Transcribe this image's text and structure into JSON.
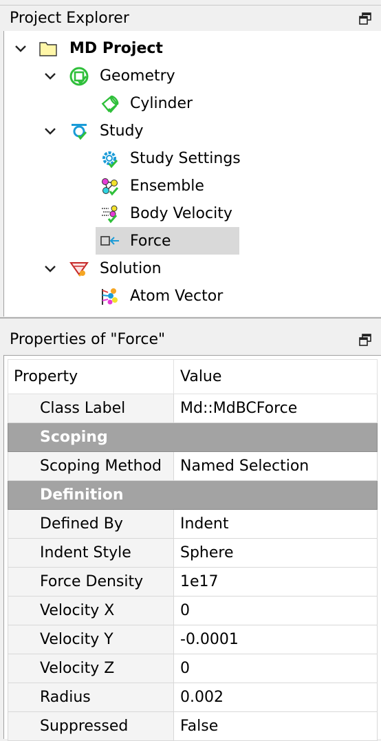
{
  "explorer": {
    "title": "Project Explorer",
    "float_icon": "float-window-icon",
    "tree": [
      {
        "label": "MD Project",
        "icon": "folder-icon",
        "expanded": true,
        "bold": true
      },
      {
        "label": "Geometry",
        "icon": "geometry-icon",
        "expanded": true
      },
      {
        "label": "Cylinder",
        "icon": "cylinder-icon"
      },
      {
        "label": "Study",
        "icon": "study-icon",
        "expanded": true
      },
      {
        "label": "Study Settings",
        "icon": "settings-gear-icon"
      },
      {
        "label": "Ensemble",
        "icon": "ensemble-icon"
      },
      {
        "label": "Body Velocity",
        "icon": "body-velocity-icon"
      },
      {
        "label": "Force",
        "icon": "force-icon",
        "selected": true
      },
      {
        "label": "Solution",
        "icon": "solution-icon",
        "expanded": true
      },
      {
        "label": "Atom Vector",
        "icon": "atom-vector-icon"
      }
    ]
  },
  "properties": {
    "title": "Properties of \"Force\"",
    "float_icon": "float-window-icon",
    "header": {
      "property": "Property",
      "value": "Value"
    },
    "rows": [
      {
        "type": "item",
        "property": "Class Label",
        "value": "Md::MdBCForce"
      },
      {
        "type": "group",
        "property": "Scoping"
      },
      {
        "type": "item",
        "property": "Scoping Method",
        "value": "Named Selection"
      },
      {
        "type": "group",
        "property": "Definition"
      },
      {
        "type": "item",
        "property": "Defined By",
        "value": "Indent"
      },
      {
        "type": "item",
        "property": "Indent Style",
        "value": "Sphere"
      },
      {
        "type": "item",
        "property": "Force Density",
        "value": "1e17"
      },
      {
        "type": "item",
        "property": "Velocity X",
        "value": "0"
      },
      {
        "type": "item",
        "property": "Velocity Y",
        "value": "-0.0001"
      },
      {
        "type": "item",
        "property": "Velocity Z",
        "value": "0"
      },
      {
        "type": "item",
        "property": "Radius",
        "value": "0.002"
      },
      {
        "type": "item",
        "property": "Suppressed",
        "value": "False"
      }
    ]
  },
  "colors": {
    "check_green": "#2fbf3a",
    "folder_fill": "#fff6a8",
    "selection": "#d9d9d9",
    "group_band": "#a3a3a3"
  }
}
